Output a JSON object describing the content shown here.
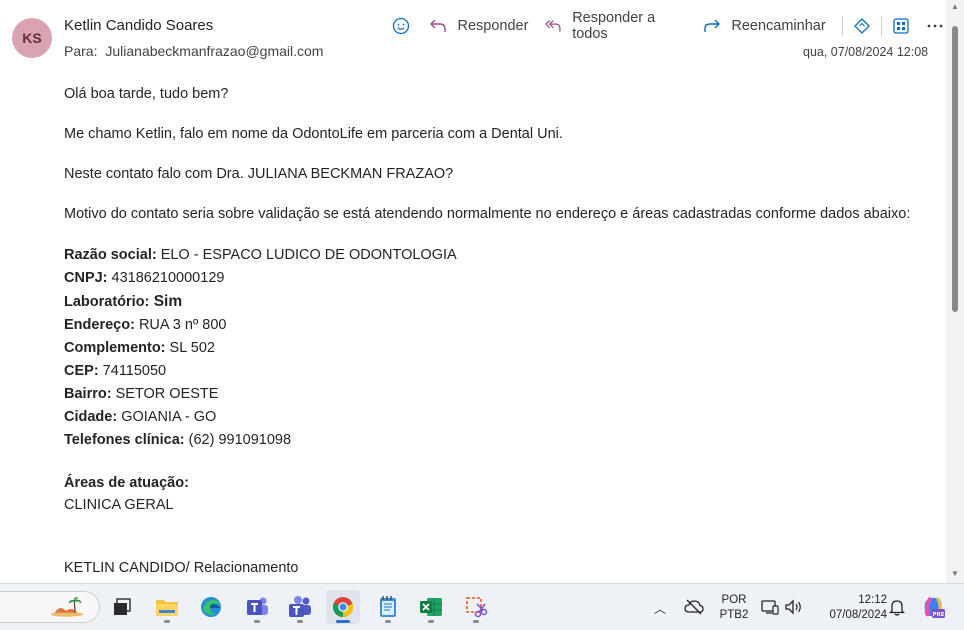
{
  "email": {
    "avatar_initials": "KS",
    "sender": "Ketlin Candido Soares",
    "to_label": "Para:",
    "to_address": "Julianabeckmanfrazao@gmail.com",
    "date": "qua, 07/08/2024 12:08",
    "actions": {
      "reply": "Responder",
      "reply_all": "Responder a todos",
      "forward": "Reencaminhar"
    }
  },
  "body": {
    "p1": "Olá boa tarde, tudo bem?",
    "p2": "Me chamo Ketlin, falo em nome da OdontoLife em parceria com a Dental Uni.",
    "p3": "Neste contato falo com Dra. JULIANA BECKMAN FRAZAO?",
    "p4": "Motivo do contato seria sobre validação se está atendendo normalmente no endereço e áreas cadastradas conforme dados abaixo:",
    "fields": [
      {
        "label": "Razão social:",
        "value": " ELO - ESPACO LUDICO DE ODONTOLOGIA"
      },
      {
        "label": "CNPJ:",
        "value": " 43186210000129"
      },
      {
        "label": "Laboratório:",
        "value": " Sim"
      },
      {
        "label": "Endereço:",
        "value": " RUA 3 nº 800"
      },
      {
        "label": "Complemento:",
        "value": " SL 502"
      },
      {
        "label": "CEP:",
        "value": " 74115050"
      },
      {
        "label": "Bairro:",
        "value": " SETOR OESTE"
      },
      {
        "label": "Cidade:",
        "value": " GOIANIA - GO"
      },
      {
        "label": "Telefones clínica:",
        "value": " (62) 991091098"
      }
    ],
    "areas_title": "Áreas de atuação:",
    "areas_value": "CLINICA GERAL",
    "signature": "KETLIN CANDIDO/ Relacionamento"
  },
  "taskbar": {
    "lang_line1": "POR",
    "lang_line2": "PTB2",
    "time": "12:12",
    "date": "07/08/2024",
    "apps": [
      "widgets-icon",
      "task-view-icon",
      "file-explorer-icon",
      "edge-icon",
      "teams-icon",
      "teams-classic-icon",
      "chrome-icon",
      "notepad-icon",
      "excel-icon",
      "snipping-tool-icon"
    ]
  },
  "colors": {
    "avatar_bg": "#d9a4b0",
    "accent": "#0f6cbd"
  }
}
